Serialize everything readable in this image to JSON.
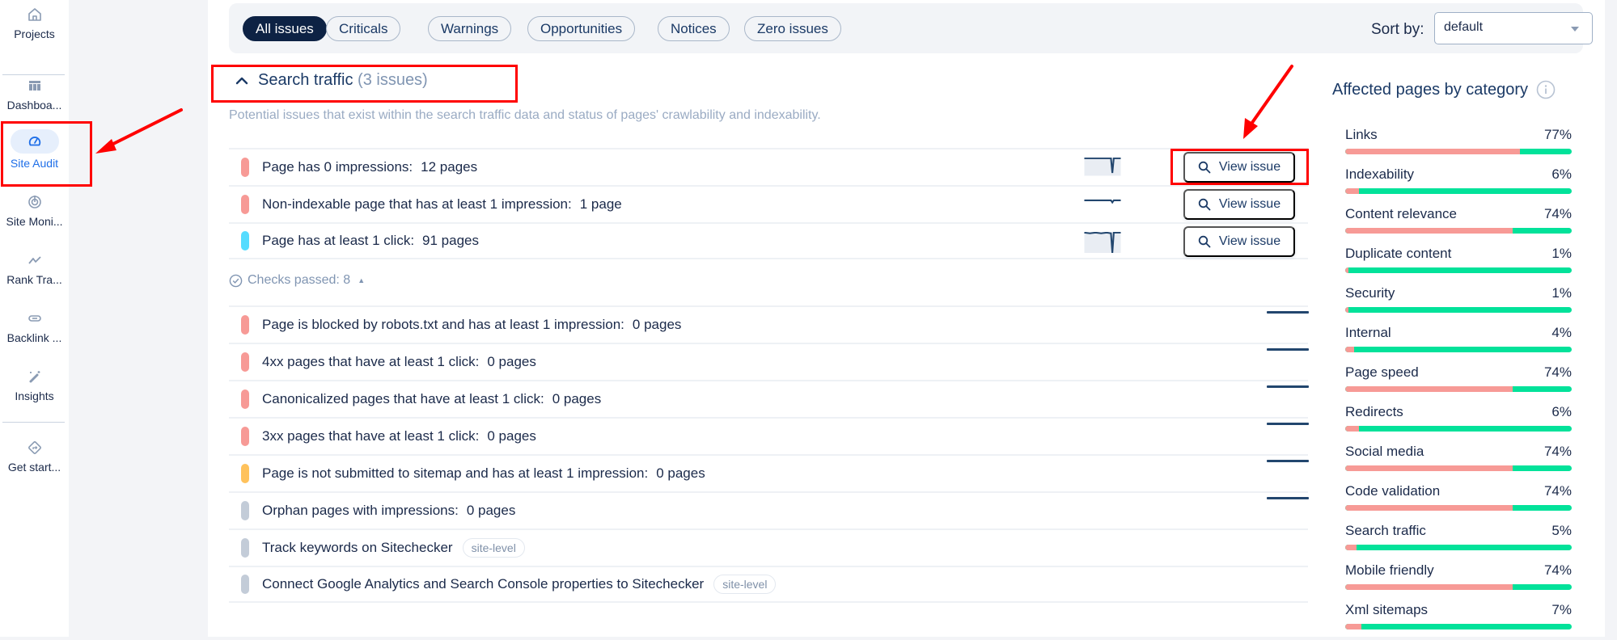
{
  "sidebar": {
    "items": [
      {
        "label": "Projects",
        "icon": "home-icon",
        "active": false
      },
      {
        "label": "Dashboa...",
        "icon": "table-icon",
        "active": false
      },
      {
        "label": "Site Audit",
        "icon": "gauge-icon",
        "active": true
      },
      {
        "label": "Site Moni...",
        "icon": "radar-icon",
        "active": false
      },
      {
        "label": "Rank Tra...",
        "icon": "trend-icon",
        "active": false
      },
      {
        "label": "Backlink ...",
        "icon": "link-icon",
        "active": false
      },
      {
        "label": "Insights",
        "icon": "magic-wand-icon",
        "active": false
      },
      {
        "label": "Get start...",
        "icon": "direction-sign-icon",
        "active": false
      }
    ]
  },
  "filters": {
    "chips": [
      "All issues",
      "Criticals",
      "Warnings",
      "Opportunities",
      "Notices",
      "Zero issues"
    ],
    "active": "All issues",
    "sort_label": "Sort by:",
    "sort_value": "default"
  },
  "section": {
    "title": "Search traffic",
    "count": "(3 issues)",
    "description": "Potential issues that exist within the search traffic data and status of pages' crawlability and indexability."
  },
  "issues": [
    {
      "title": "Page has 0 impressions:",
      "value": "12 pages",
      "severity_color": "#f79a96",
      "button": "View issue"
    },
    {
      "title": "Non-indexable page that has at least 1 impression:",
      "value": "1 page",
      "severity_color": "#f79a96",
      "button": "View issue"
    },
    {
      "title": "Page has at least 1 click:",
      "value": "91 pages",
      "severity_color": "#56dcff",
      "button": "View issue"
    }
  ],
  "checks_passed": {
    "label": "Checks passed: 8"
  },
  "passed": [
    {
      "title": "Page is blocked by robots.txt and has at least 1 impression:",
      "value": "0 pages",
      "severity_color": "#f79a96"
    },
    {
      "title": "4xx pages that have at least 1 click:",
      "value": "0 pages",
      "severity_color": "#f79a96"
    },
    {
      "title": "Canonicalized pages that have at least 1 click:",
      "value": "0 pages",
      "severity_color": "#f79a96"
    },
    {
      "title": "3xx pages that have at least 1 click:",
      "value": "0 pages",
      "severity_color": "#f79a96"
    },
    {
      "title": "Page is not submitted to sitemap and has at least 1 impression:",
      "value": "0 pages",
      "severity_color": "#ffc25c"
    },
    {
      "title": "Orphan pages with impressions:",
      "value": "0 pages",
      "severity_color": "#c3ccd8"
    },
    {
      "title": "Track keywords on Sitechecker",
      "badge": "site-level",
      "severity_color": "#c3ccd8"
    },
    {
      "title": "Connect Google Analytics and Search Console properties to Sitechecker",
      "badge": "site-level",
      "severity_color": "#c3ccd8"
    }
  ],
  "categories": {
    "title": "Affected pages by category",
    "items": [
      {
        "name": "Links",
        "percent": "77%",
        "value": 77
      },
      {
        "name": "Indexability",
        "percent": "6%",
        "value": 6
      },
      {
        "name": "Content relevance",
        "percent": "74%",
        "value": 74
      },
      {
        "name": "Duplicate content",
        "percent": "1%",
        "value": 1
      },
      {
        "name": "Security",
        "percent": "1%",
        "value": 1
      },
      {
        "name": "Internal",
        "percent": "4%",
        "value": 4
      },
      {
        "name": "Page speed",
        "percent": "74%",
        "value": 74
      },
      {
        "name": "Redirects",
        "percent": "6%",
        "value": 6
      },
      {
        "name": "Social media",
        "percent": "74%",
        "value": 74
      },
      {
        "name": "Code validation",
        "percent": "74%",
        "value": 74
      },
      {
        "name": "Search traffic",
        "percent": "5%",
        "value": 5
      },
      {
        "name": "Mobile friendly",
        "percent": "74%",
        "value": 74
      },
      {
        "name": "Xml sitemaps",
        "percent": "7%",
        "value": 7
      }
    ]
  },
  "colors": {
    "affected": "#f79a96",
    "ok": "#02e29a",
    "accent": "#1f6fe8",
    "annotation": "#ff0000"
  }
}
